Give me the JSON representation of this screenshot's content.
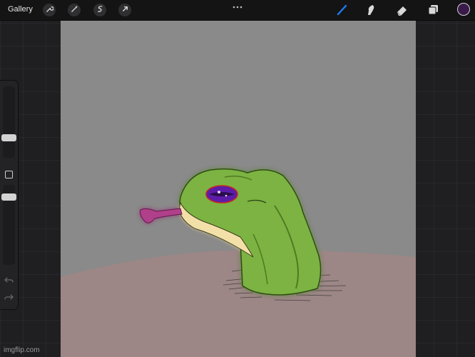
{
  "toolbar": {
    "gallery_label": "Gallery",
    "left_tools": [
      {
        "name": "wrench-icon",
        "title": "Actions"
      },
      {
        "name": "magic-wand-icon",
        "title": "Adjustments"
      },
      {
        "name": "selection-icon",
        "title": "Selection"
      },
      {
        "name": "transform-arrow-icon",
        "title": "Transform"
      }
    ],
    "right_tools": [
      {
        "name": "brush-icon",
        "title": "Paint",
        "active": true
      },
      {
        "name": "smudge-icon",
        "title": "Smudge"
      },
      {
        "name": "eraser-icon",
        "title": "Eraser"
      },
      {
        "name": "layers-icon",
        "title": "Layers"
      }
    ],
    "active_color": "#3a1a4a",
    "accent_color": "#1e7cf2"
  },
  "sidebar": {
    "brush_size_level": 0.75,
    "opacity_level": 0.75
  },
  "canvas": {
    "background_color": "#8a8a8a",
    "ground_color": "#9c8686",
    "subject": "green frog head emerging from ground with purple eye and pink tongue"
  },
  "watermark": "imgflip.com"
}
